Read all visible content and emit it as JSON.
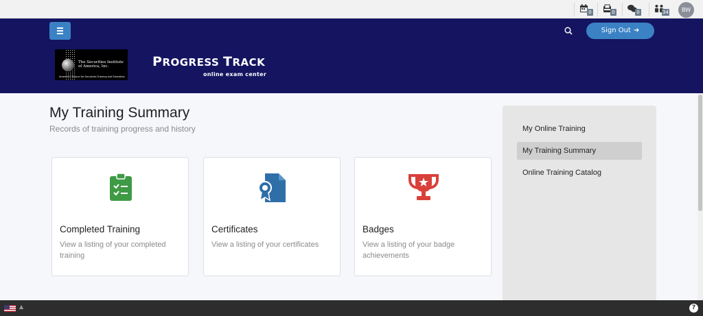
{
  "topbar": {
    "icons": [
      {
        "name": "calendar-icon",
        "count": "0"
      },
      {
        "name": "inbox-icon",
        "count": "0"
      },
      {
        "name": "chat-icon",
        "count": "0"
      },
      {
        "name": "users-icon",
        "count": "34"
      }
    ],
    "avatar_initials": "BW"
  },
  "header": {
    "signout_label": "Sign Out",
    "logo_line1": "The Securities Institute",
    "logo_line2": "of America, Inc.",
    "logo_tagline": "America's Source for Securities Training and Education",
    "brand_title_big1": "P",
    "brand_title_small1": "ROGRESS ",
    "brand_title_big2": "T",
    "brand_title_small2": "RACK",
    "brand_subtitle": "online exam center"
  },
  "main": {
    "title": "My Training Summary",
    "subtitle": "Records of training progress and history",
    "cards": [
      {
        "title": "Completed Training",
        "description": "View a listing of your completed training",
        "icon": "clipboard-check-icon",
        "color": "#3f9a45"
      },
      {
        "title": "Certificates",
        "description": "View a listing of your certificates",
        "icon": "certificate-icon",
        "color": "#2f6fa8"
      },
      {
        "title": "Badges",
        "description": "View a listing of your badge achievements",
        "icon": "trophy-icon",
        "color": "#d9403a"
      }
    ]
  },
  "sidebar": {
    "items": [
      {
        "label": "My Online Training",
        "active": false
      },
      {
        "label": "My Training Summary",
        "active": true
      },
      {
        "label": "Online Training Catalog",
        "active": false
      }
    ]
  },
  "colors": {
    "navy": "#141460",
    "accent": "#3b82c4"
  }
}
